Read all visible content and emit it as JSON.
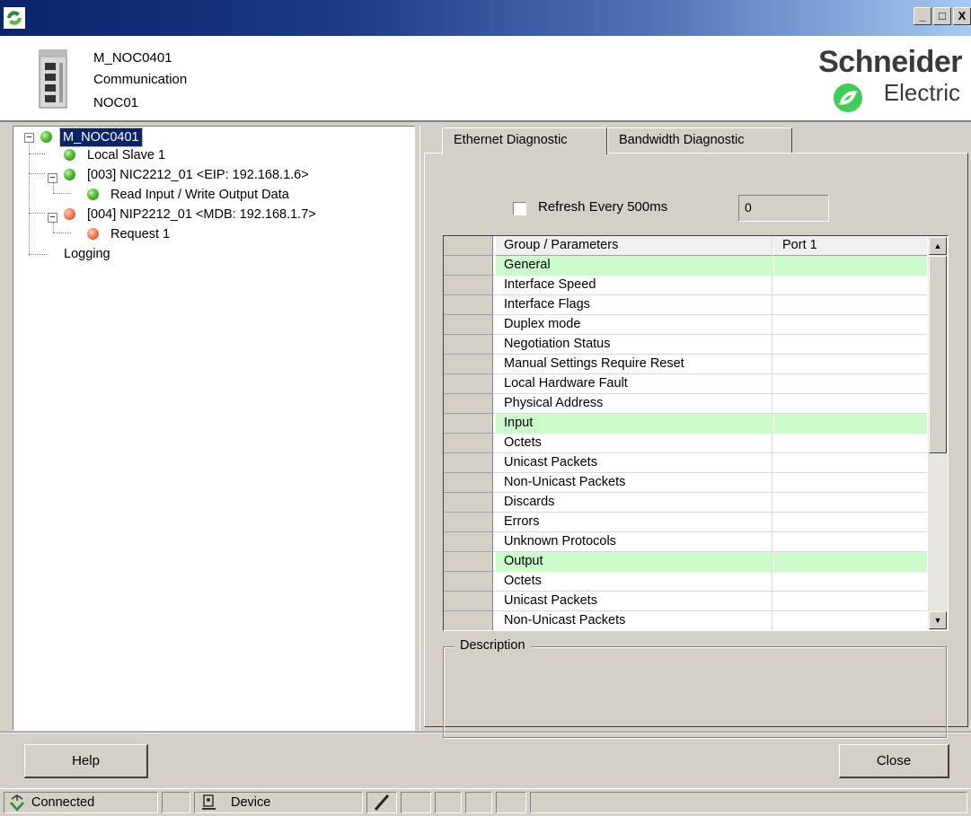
{
  "window": {
    "minimize": "_",
    "maximize": "□",
    "close": "X"
  },
  "header": {
    "device_name": "M_NOC0401",
    "category": "Communication",
    "instance": "NOC01",
    "logo_line1": "Schneider",
    "logo_line2": "Electric"
  },
  "tree": {
    "root": "M_NOC0401",
    "local_slave": "Local Slave 1",
    "nic": "[003] NIC2212_01 <EIP: 192.168.1.6>",
    "nic_child": "Read Input / Write Output Data",
    "nip": "[004] NIP2212_01 <MDB: 192.168.1.7>",
    "nip_child": "Request 1",
    "logging": "Logging"
  },
  "tabs": {
    "ethernet": "Ethernet Diagnostic",
    "bandwidth": "Bandwidth Diagnostic"
  },
  "refresh": {
    "label": "Refresh Every 500ms",
    "counter": "0"
  },
  "grid": {
    "col_group": "Group / Parameters",
    "col_port": "Port 1",
    "rows": [
      {
        "label": "General",
        "value": "",
        "group": true
      },
      {
        "label": "Interface Speed",
        "value": "",
        "group": false
      },
      {
        "label": "Interface Flags",
        "value": "",
        "group": false
      },
      {
        "label": "Duplex mode",
        "value": "",
        "group": false
      },
      {
        "label": "Negotiation Status",
        "value": "",
        "group": false
      },
      {
        "label": "Manual Settings Require Reset",
        "value": "",
        "group": false
      },
      {
        "label": "Local Hardware Fault",
        "value": "",
        "group": false
      },
      {
        "label": "Physical Address",
        "value": "",
        "group": false
      },
      {
        "label": "Input",
        "value": "",
        "group": true
      },
      {
        "label": "Octets",
        "value": "",
        "group": false
      },
      {
        "label": "Unicast Packets",
        "value": "",
        "group": false
      },
      {
        "label": "Non-Unicast Packets",
        "value": "",
        "group": false
      },
      {
        "label": "Discards",
        "value": "",
        "group": false
      },
      {
        "label": "Errors",
        "value": "",
        "group": false
      },
      {
        "label": "Unknown Protocols",
        "value": "",
        "group": false
      },
      {
        "label": "Output",
        "value": "",
        "group": true
      },
      {
        "label": "Octets",
        "value": "",
        "group": false
      },
      {
        "label": "Unicast Packets",
        "value": "",
        "group": false
      },
      {
        "label": "Non-Unicast Packets",
        "value": "",
        "group": false
      }
    ]
  },
  "description": {
    "title": "Description"
  },
  "buttons": {
    "help": "Help",
    "close": "Close"
  },
  "status": {
    "connection": "Connected",
    "mode": "Device"
  },
  "colors": {
    "group_row": "#ccfccc",
    "selection": "#0a246a",
    "status_ok": "#4fc030",
    "status_warn": "#f07a50"
  }
}
